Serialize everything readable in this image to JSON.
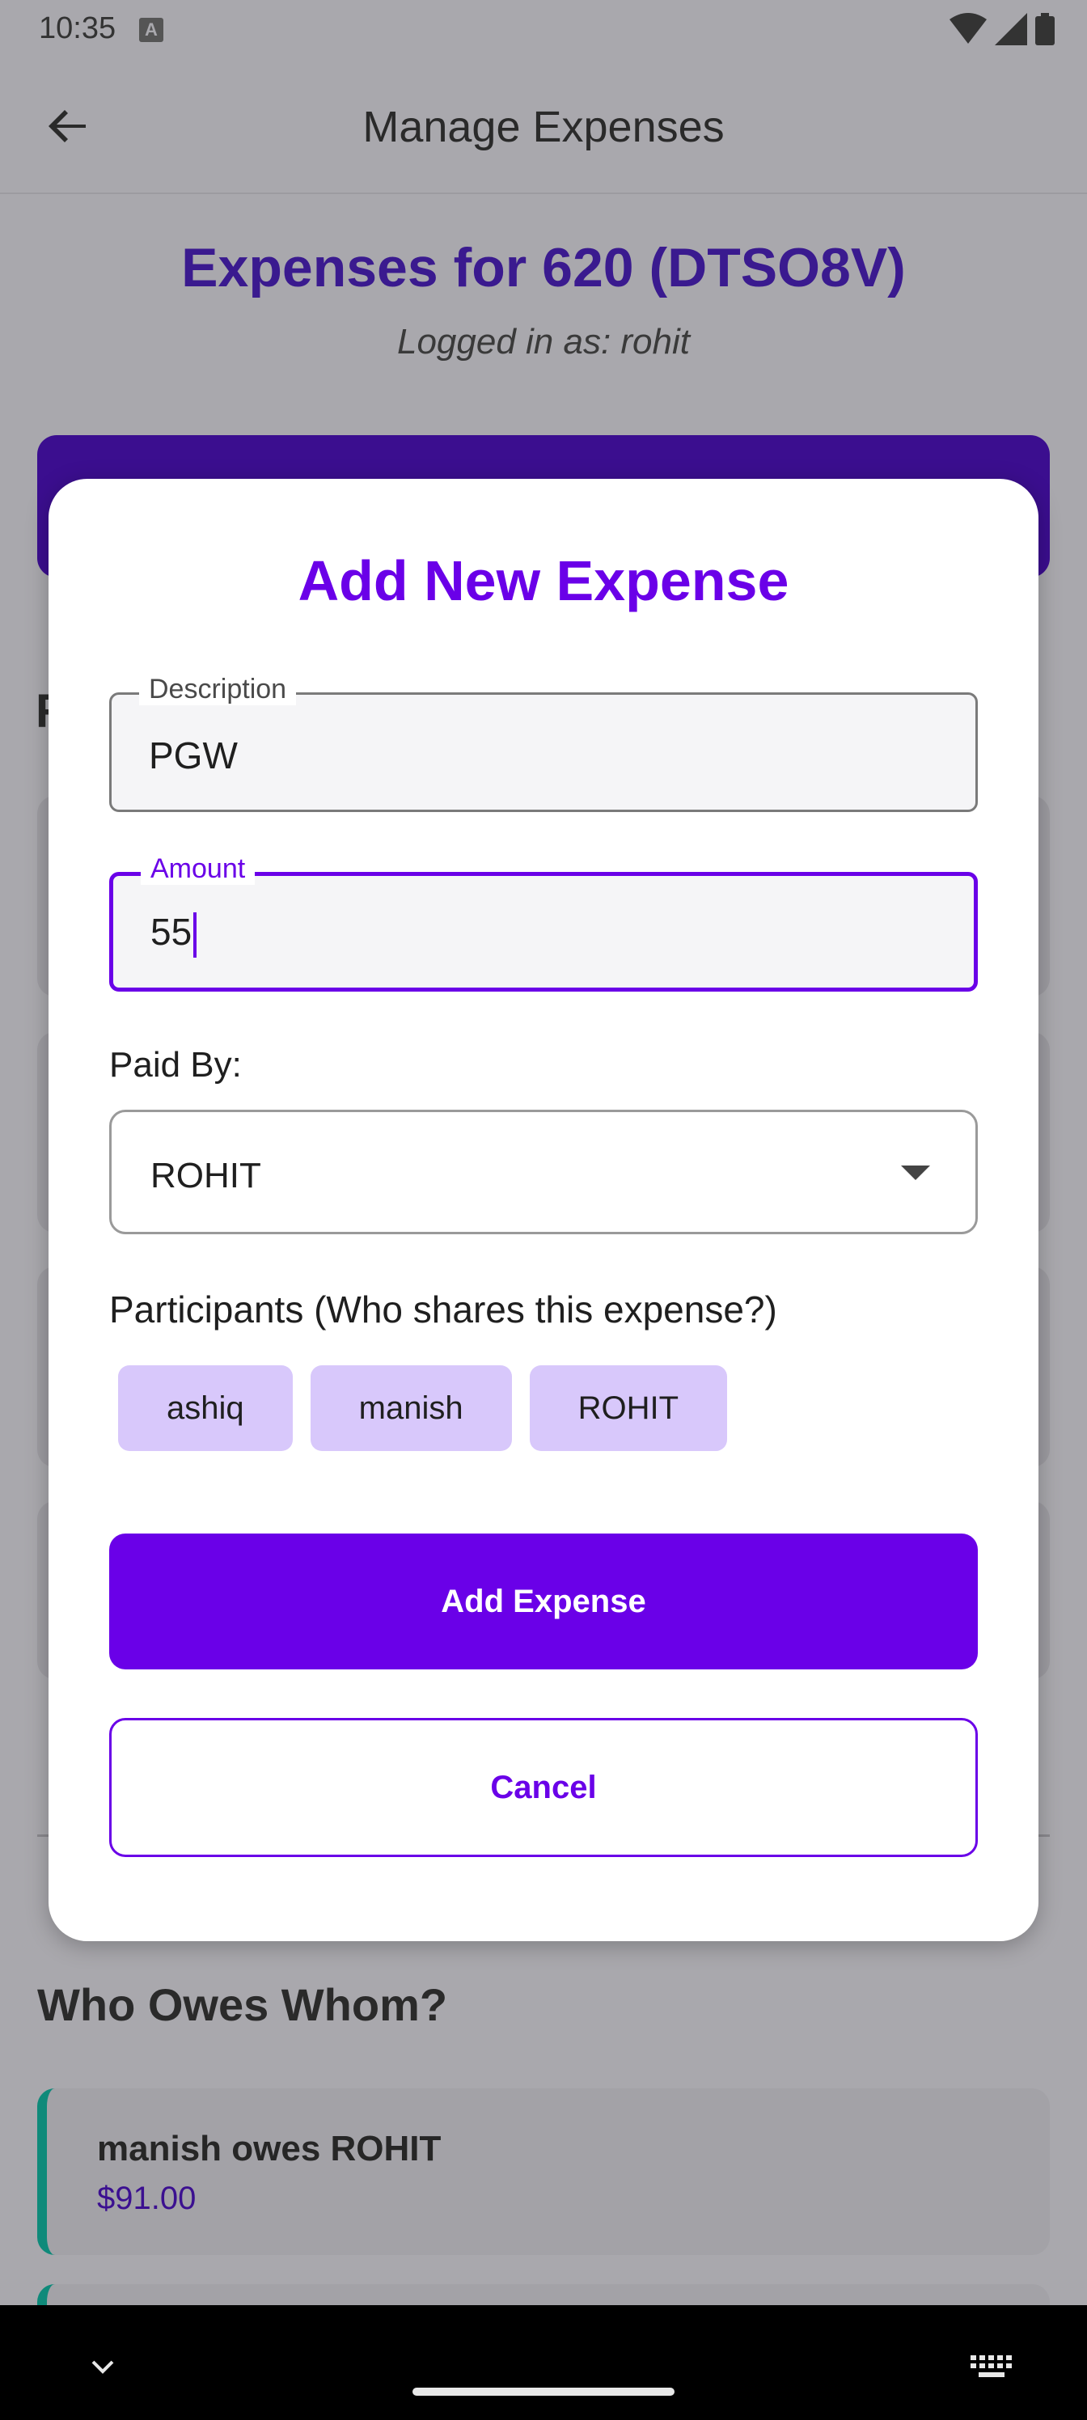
{
  "status_bar": {
    "time": "10:35",
    "notification_icon": "a-icon",
    "icons": [
      "wifi-icon",
      "cellular-signal-icon",
      "battery-icon"
    ]
  },
  "app_bar": {
    "title": "Manage Expenses",
    "back_icon": "arrow-left-icon"
  },
  "background": {
    "heading": "Expenses for 620 (DTSO8V)",
    "logged_in": "Logged in as: rohit",
    "left_glimpse": "R",
    "who_owes_heading": "Who Owes Whom?",
    "owe_items": [
      {
        "text": "manish owes ROHIT",
        "amount": "$91.00"
      }
    ]
  },
  "dialog": {
    "title": "Add New Expense",
    "description": {
      "label": "Description",
      "value": "PGW"
    },
    "amount": {
      "label": "Amount",
      "value": "55"
    },
    "paid_by": {
      "label": "Paid By:",
      "value": "ROHIT",
      "icon": "dropdown-arrow-icon"
    },
    "participants": {
      "label": "Participants (Who shares this expense?)",
      "chips": [
        "ashiq",
        "manish",
        "ROHIT"
      ]
    },
    "add_button": "Add Expense",
    "cancel_button": "Cancel"
  },
  "colors": {
    "accent": "#6a00e8",
    "chip": "#d8c8fb",
    "scrim": "#a9a8ad"
  }
}
